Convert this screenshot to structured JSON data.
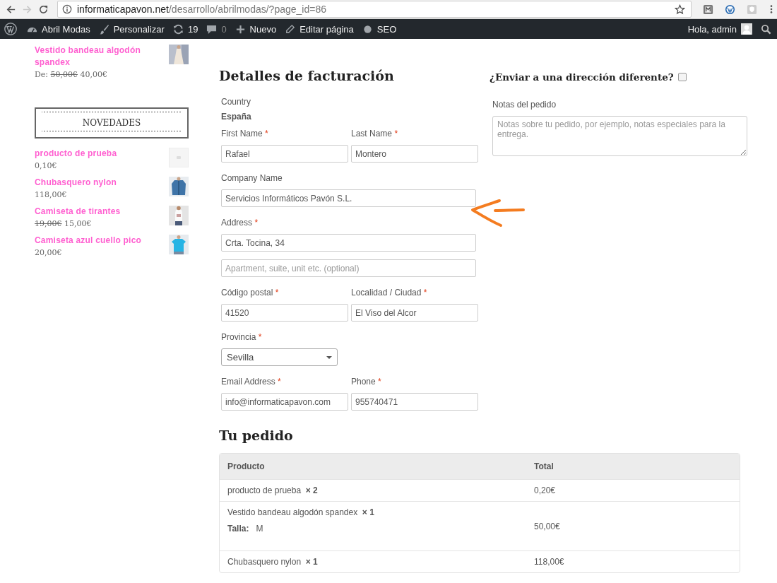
{
  "browser": {
    "url_domain": "informaticapavon.net",
    "url_path": "/desarrollo/abrilmodas/?page_id=86",
    "forward_disabled": true
  },
  "admin_bar": {
    "items": [
      {
        "kind": "logo"
      },
      {
        "kind": "site",
        "label": "Abril Modas"
      },
      {
        "kind": "customize",
        "label": "Personalizar"
      },
      {
        "kind": "updates",
        "label": "19"
      },
      {
        "kind": "comments",
        "label": "0"
      },
      {
        "kind": "new",
        "label": "Nuevo"
      },
      {
        "kind": "edit",
        "label": "Editar página"
      },
      {
        "kind": "seo",
        "label": "SEO"
      }
    ],
    "greeting": "Hola, admin"
  },
  "sidebar": {
    "top_products": [
      {
        "name": "Vestido bandeau algodón spandex",
        "price_prefix": "De:",
        "old_price": "50,00€",
        "price": "40,00€"
      }
    ],
    "widget_title": "NOVEDADES",
    "new_products": [
      {
        "name": "producto de prueba",
        "price": "0,10€"
      },
      {
        "name": "Chubasquero nylon",
        "price": "118,00€"
      },
      {
        "name": "Camiseta de tirantes",
        "old_price": "19,00€",
        "price": "15,00€"
      },
      {
        "name": "Camiseta azul cuello pico",
        "price": "20,00€"
      }
    ]
  },
  "billing": {
    "title": "Detalles de facturación",
    "rows": [
      {
        "fields": [
          {
            "kind": "static",
            "label": "Country",
            "value": "España"
          }
        ]
      },
      {
        "fields": [
          {
            "kind": "text",
            "label": "First Name",
            "required_mark": "*",
            "value": "Rafael"
          },
          {
            "kind": "text",
            "label": "Last Name",
            "required_mark": "*",
            "value": "Montero"
          }
        ]
      },
      {
        "fields": [
          {
            "kind": "text",
            "label": "Company Name",
            "value": "Servicios Informáticos Pavón S.L."
          }
        ]
      },
      {
        "fields": [
          {
            "kind": "text",
            "label": "Address",
            "required_mark": "*",
            "value": "Crta. Tocina, 34"
          }
        ]
      },
      {
        "fields": [
          {
            "kind": "text",
            "placeholder": "Apartment, suite, unit etc. (optional)"
          }
        ]
      },
      {
        "fields": [
          {
            "kind": "text",
            "label": "Código postal",
            "required_mark": "*",
            "value": "41520"
          },
          {
            "kind": "text",
            "label": "Localidad / Ciudad",
            "required_mark": "*",
            "value": "El Viso del Alcor"
          }
        ]
      },
      {
        "fields": [
          {
            "kind": "select",
            "label": "Provincia",
            "required_mark": "*",
            "value": "Sevilla"
          }
        ]
      },
      {
        "fields": [
          {
            "kind": "text",
            "label": "Email Address",
            "required_mark": "*",
            "value": "info@informaticapavon.com"
          },
          {
            "kind": "text",
            "label": "Phone",
            "required_mark": "*",
            "value": "955740471"
          }
        ]
      }
    ]
  },
  "shipping": {
    "title": "¿Enviar a una dirección diferente?",
    "checked": false,
    "notes_label": "Notas del pedido",
    "notes_placeholder": "Notas sobre tu pedido, por ejemplo, notas especiales para la entrega."
  },
  "order": {
    "title": "Tu pedido",
    "columns": [
      "Producto",
      "Total"
    ],
    "rows": [
      {
        "product": "producto de prueba",
        "quantity": "× 2",
        "total": "0,20€"
      },
      {
        "product": "Vestido bandeau algodón spandex",
        "quantity": "× 1",
        "meta": [
          {
            "label": "Talla:",
            "value": "M"
          }
        ],
        "total": "50,00€"
      },
      {
        "product": "Chubasquero nylon",
        "quantity": "× 1",
        "total": "118,00€"
      }
    ]
  }
}
